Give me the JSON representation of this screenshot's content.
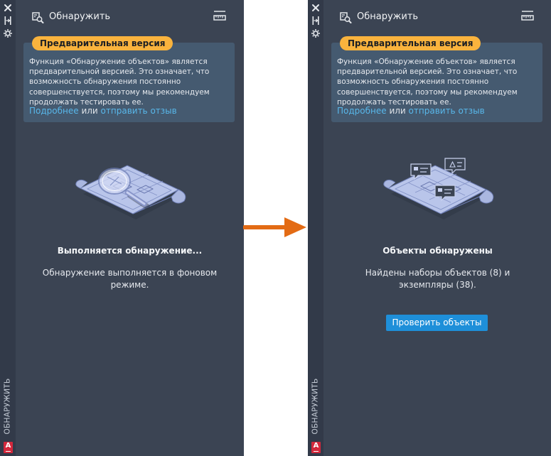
{
  "palette_title": "ОБНАРУЖИТЬ",
  "panel_title": "Обнаружить",
  "app_logo": "A",
  "preview": {
    "badge": "Предварительная версия",
    "text": "Функция «Обнаружение объектов» является предварительной версией. Это означает, что возможность обнаружения постоянно совершенствуется, поэтому мы рекомендуем продолжать тестировать ее.",
    "link_more": "Подробнее",
    "or": " или ",
    "link_feedback": "отправить отзыв"
  },
  "before": {
    "status_title": "Выполняется обнаружение...",
    "status_message": "Обнаружение выполняется в фоновом режиме."
  },
  "after": {
    "status_title": "Объекты обнаружены",
    "status_message": "Найдены наборы объектов (8) и экземпляры (38).",
    "button_label": "Проверить объекты"
  },
  "icons": {
    "close": "close-icon",
    "pin": "auto-hide-icon",
    "settings": "properties-icon",
    "discover": "discover-icon",
    "toolbar": "ruler-icon",
    "illustration_before": "magnifier-over-drawing",
    "illustration_after": "drawing-with-markers",
    "transition": "arrow-right-icon"
  },
  "colors": {
    "panel_bg": "#3b4453",
    "strip_bg": "#323a49",
    "banner_bg": "#455a70",
    "badge_bg": "#f9b33d",
    "link": "#58b7ea",
    "button_bg": "#1e8fd9",
    "arrow": "#e36b14",
    "logo_bg": "#d3283c"
  }
}
